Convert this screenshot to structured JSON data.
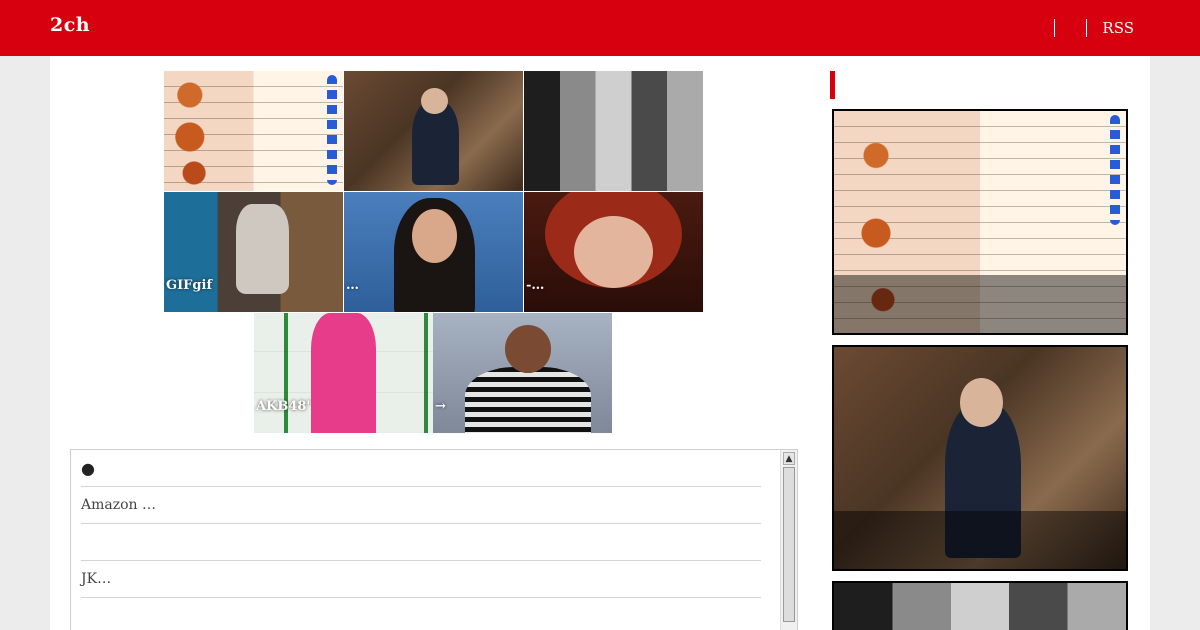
{
  "header": {
    "logo": "2ch",
    "nav": {
      "rss": "RSS"
    }
  },
  "gallery": {
    "tiles": [
      {
        "caption": ""
      },
      {
        "caption": ""
      },
      {
        "caption": ""
      },
      {
        "caption": "GIFgif"
      },
      {
        "caption": "…"
      },
      {
        "caption": "-…"
      },
      {
        "caption": "AKB48\"\"…"
      },
      {
        "caption": "→"
      }
    ]
  },
  "comments": {
    "rows": [
      {
        "text": "●"
      },
      {
        "text": "Amazon …"
      },
      {
        "text": ""
      },
      {
        "text": "JK…"
      }
    ],
    "scroll_up": "▲"
  },
  "sidebar": {
    "heading": ""
  }
}
